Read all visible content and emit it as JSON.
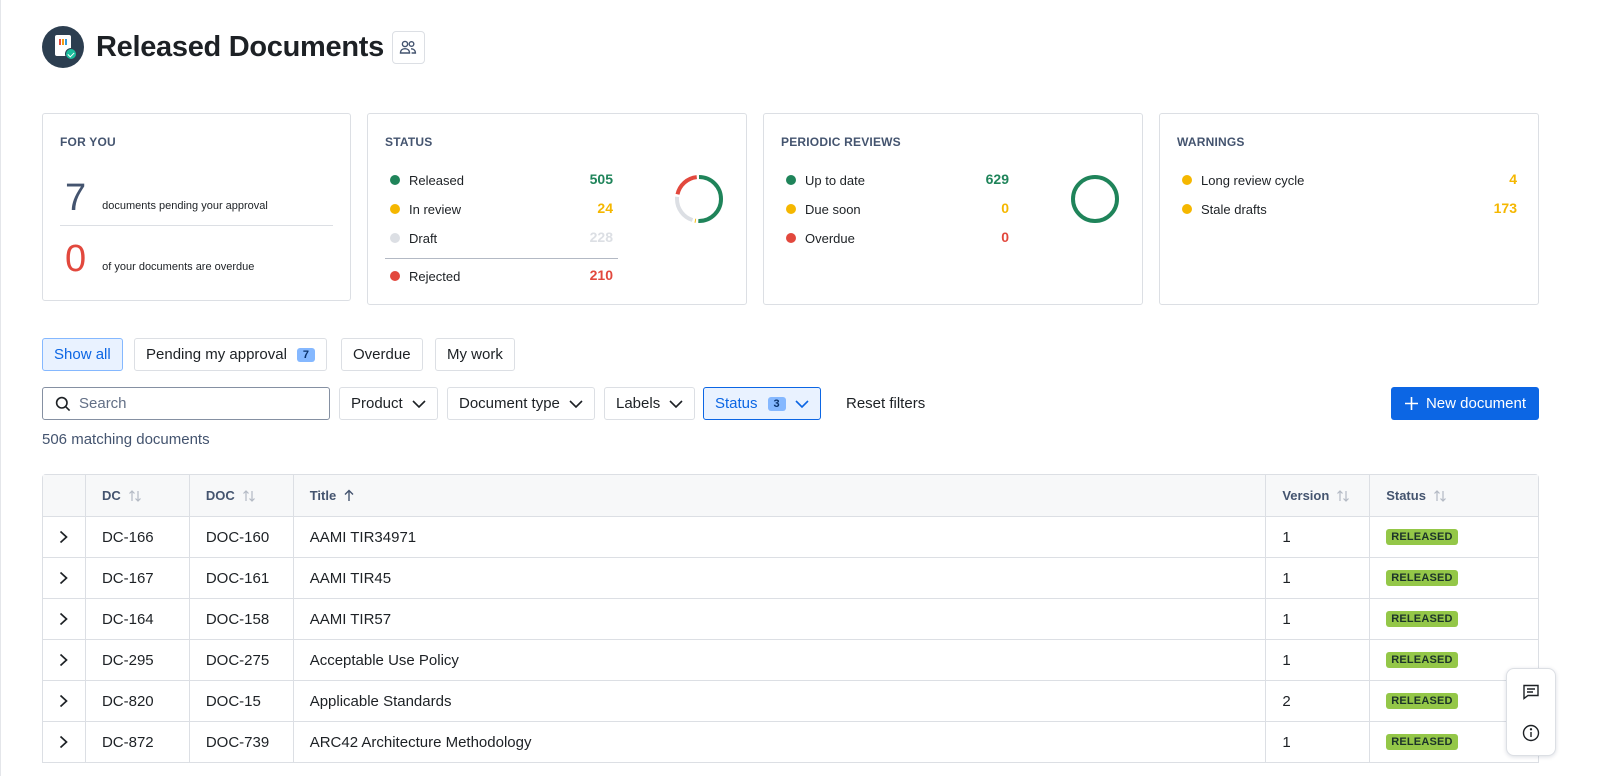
{
  "page": {
    "title": "Released Documents"
  },
  "for_you": {
    "title": "FOR YOU",
    "pending": {
      "count": "7",
      "text": "documents pending your approval",
      "color": "#44546f"
    },
    "overdue": {
      "count": "0",
      "text": "of your documents are overdue",
      "color": "#e2483d"
    }
  },
  "status": {
    "title": "STATUS",
    "items": [
      {
        "label": "Released",
        "value": "505",
        "color": "#1f845a"
      },
      {
        "label": "In review",
        "value": "24",
        "color": "#f5b700"
      },
      {
        "label": "Draft",
        "value": "228",
        "color": "#dcdfe4"
      },
      {
        "label": "Rejected",
        "value": "210",
        "color": "#e2483d"
      }
    ]
  },
  "periodic_reviews": {
    "title": "PERIODIC REVIEWS",
    "items": [
      {
        "label": "Up to date",
        "value": "629",
        "color": "#1f845a"
      },
      {
        "label": "Due soon",
        "value": "0",
        "color": "#f5b700"
      },
      {
        "label": "Overdue",
        "value": "0",
        "color": "#e2483d"
      }
    ]
  },
  "warnings": {
    "title": "WARNINGS",
    "items": [
      {
        "label": "Long review cycle",
        "value": "4",
        "color": "#f5b700"
      },
      {
        "label": "Stale drafts",
        "value": "173",
        "color": "#f5b700"
      }
    ]
  },
  "tabs": {
    "show_all": "Show all",
    "pending": "Pending my approval",
    "pending_count": "7",
    "overdue": "Overdue",
    "my_work": "My work"
  },
  "filters": {
    "search_placeholder": "Search",
    "product": "Product",
    "doc_type": "Document type",
    "labels": "Labels",
    "status": "Status",
    "status_count": "3",
    "reset": "Reset filters",
    "new_document": "New document"
  },
  "matching": "506 matching documents",
  "table": {
    "columns": {
      "dc": "DC",
      "doc": "DOC",
      "title": "Title",
      "version": "Version",
      "status": "Status"
    },
    "rows": [
      {
        "dc": "DC-166",
        "doc": "DOC-160",
        "title": "AAMI TIR34971",
        "version": "1",
        "status": "RELEASED"
      },
      {
        "dc": "DC-167",
        "doc": "DOC-161",
        "title": "AAMI TIR45",
        "version": "1",
        "status": "RELEASED"
      },
      {
        "dc": "DC-164",
        "doc": "DOC-158",
        "title": "AAMI TIR57",
        "version": "1",
        "status": "RELEASED"
      },
      {
        "dc": "DC-295",
        "doc": "DOC-275",
        "title": "Acceptable Use Policy",
        "version": "1",
        "status": "RELEASED"
      },
      {
        "dc": "DC-820",
        "doc": "DOC-15",
        "title": "Applicable Standards",
        "version": "2",
        "status": "RELEASED"
      },
      {
        "dc": "DC-872",
        "doc": "DOC-739",
        "title": "ARC42 Architecture Methodology",
        "version": "1",
        "status": "RELEASED"
      }
    ]
  }
}
